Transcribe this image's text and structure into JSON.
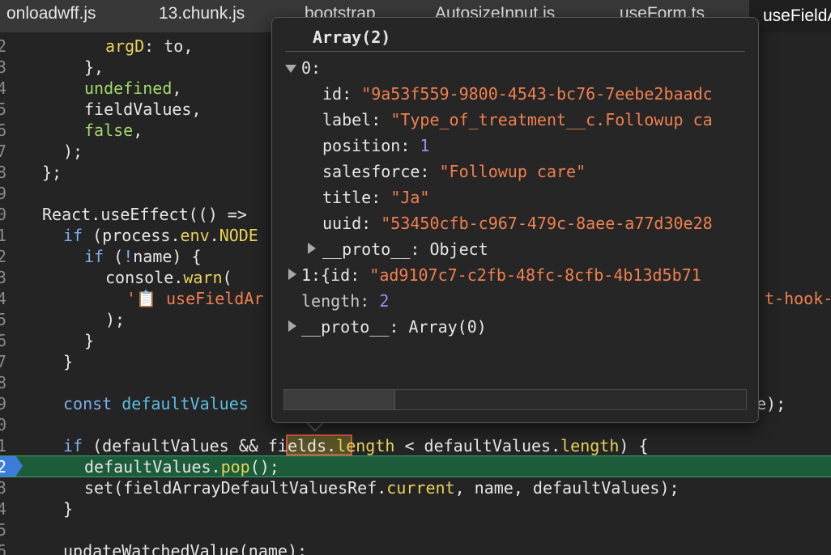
{
  "tabs": [
    {
      "label": "onloadwff.js",
      "active": false
    },
    {
      "label": "13.chunk.js",
      "active": false
    },
    {
      "label": "bootstrap",
      "active": false
    },
    {
      "label": "AutosizeInput.js",
      "active": false
    },
    {
      "label": "useForm.ts",
      "active": false
    },
    {
      "label": "useFieldArray.ts",
      "active": true
    }
  ],
  "gutter": [
    "2",
    "3",
    "4",
    "5",
    "6",
    "7",
    "8",
    "9",
    "0",
    "1",
    "2",
    "3",
    "4",
    "5",
    "6",
    "7",
    "8",
    "9",
    "0",
    "1",
    "2",
    "3",
    "4",
    "5",
    "6"
  ],
  "code": {
    "l1": [
      "argD",
      ": to,"
    ],
    "l2": "},",
    "l3": [
      "undefined",
      ","
    ],
    "l4": "fieldValues,",
    "l5": [
      "false",
      ","
    ],
    "l6": ");",
    "l7": "};",
    "l9": "React.useEffect(() =>",
    "l10": [
      "if",
      " (process.",
      "env",
      ".",
      "NODE"
    ],
    "l11": [
      "if",
      " (",
      "!",
      "name) {"
    ],
    "l12": [
      "console.",
      "warn",
      "("
    ],
    "l13": [
      "'📋 useFieldAr",
      "t-hook-"
    ],
    "l14": ");",
    "l15": "}",
    "l16": "}",
    "l18": [
      "const",
      " ",
      "defaultValues",
      "e);"
    ],
    "l20": [
      "if",
      " (defaultValues && ",
      "fields",
      ".",
      "length",
      " < defaultValues.",
      "length",
      ") {"
    ],
    "l21": [
      "defaultValues.",
      "pop",
      "();"
    ],
    "l22": [
      "set(fieldArrayDefaultValuesRef.",
      "current",
      ", name, defaultValues);"
    ],
    "l23": "}",
    "l25": "updateWatchedValue(name);"
  },
  "popover": {
    "title": "Array(2)",
    "item0_index": "0:",
    "fields": [
      {
        "key": "id",
        "value": "\"9a53f559-9800-4543-bc76-7eebe2baadc",
        "type": "str"
      },
      {
        "key": "label",
        "value": "\"Type_of_treatment__c.Followup ca",
        "type": "str"
      },
      {
        "key": "position",
        "value": "1",
        "type": "num"
      },
      {
        "key": "salesforce",
        "value": "\"Followup care\"",
        "type": "str"
      },
      {
        "key": "title",
        "value": "\"Ja\"",
        "type": "str"
      },
      {
        "key": "uuid",
        "value": "\"53450cfb-c967-479c-8aee-a77d30e28",
        "type": "str"
      }
    ],
    "proto_obj_key": "__proto__",
    "proto_obj_val": "Object",
    "item1_index": "1:",
    "item1_prefix": "{id: ",
    "item1_value": "\"ad9107c7-c2fb-48fc-8cfb-4b13d5b71",
    "length_key": "length",
    "length_val": "2",
    "proto_arr_key": "__proto__",
    "proto_arr_val": "Array(0)"
  }
}
